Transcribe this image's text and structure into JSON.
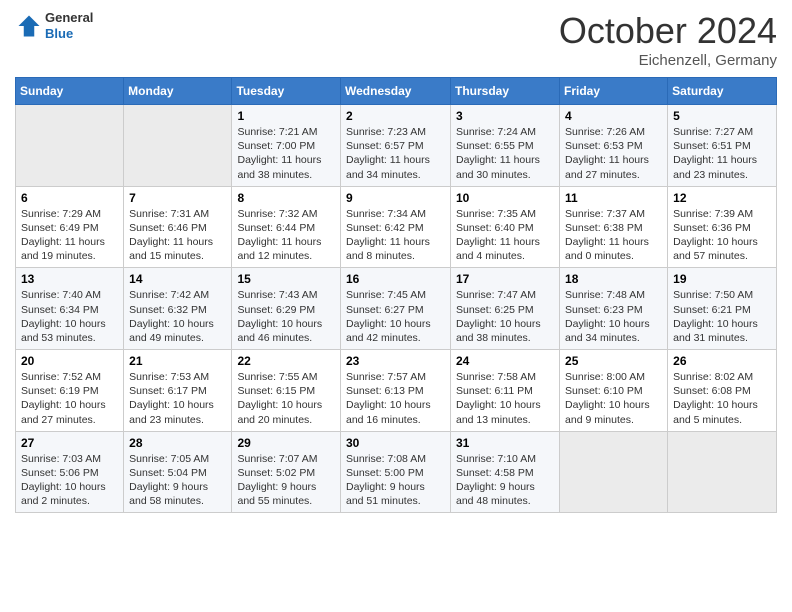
{
  "header": {
    "logo": {
      "general": "General",
      "blue": "Blue"
    },
    "month": "October 2024",
    "location": "Eichenzell, Germany"
  },
  "weekdays": [
    "Sunday",
    "Monday",
    "Tuesday",
    "Wednesday",
    "Thursday",
    "Friday",
    "Saturday"
  ],
  "weeks": [
    [
      {
        "day": "",
        "empty": true
      },
      {
        "day": "",
        "empty": true
      },
      {
        "day": "1",
        "sunrise": "Sunrise: 7:21 AM",
        "sunset": "Sunset: 7:00 PM",
        "daylight": "Daylight: 11 hours and 38 minutes."
      },
      {
        "day": "2",
        "sunrise": "Sunrise: 7:23 AM",
        "sunset": "Sunset: 6:57 PM",
        "daylight": "Daylight: 11 hours and 34 minutes."
      },
      {
        "day": "3",
        "sunrise": "Sunrise: 7:24 AM",
        "sunset": "Sunset: 6:55 PM",
        "daylight": "Daylight: 11 hours and 30 minutes."
      },
      {
        "day": "4",
        "sunrise": "Sunrise: 7:26 AM",
        "sunset": "Sunset: 6:53 PM",
        "daylight": "Daylight: 11 hours and 27 minutes."
      },
      {
        "day": "5",
        "sunrise": "Sunrise: 7:27 AM",
        "sunset": "Sunset: 6:51 PM",
        "daylight": "Daylight: 11 hours and 23 minutes."
      }
    ],
    [
      {
        "day": "6",
        "sunrise": "Sunrise: 7:29 AM",
        "sunset": "Sunset: 6:49 PM",
        "daylight": "Daylight: 11 hours and 19 minutes."
      },
      {
        "day": "7",
        "sunrise": "Sunrise: 7:31 AM",
        "sunset": "Sunset: 6:46 PM",
        "daylight": "Daylight: 11 hours and 15 minutes."
      },
      {
        "day": "8",
        "sunrise": "Sunrise: 7:32 AM",
        "sunset": "Sunset: 6:44 PM",
        "daylight": "Daylight: 11 hours and 12 minutes."
      },
      {
        "day": "9",
        "sunrise": "Sunrise: 7:34 AM",
        "sunset": "Sunset: 6:42 PM",
        "daylight": "Daylight: 11 hours and 8 minutes."
      },
      {
        "day": "10",
        "sunrise": "Sunrise: 7:35 AM",
        "sunset": "Sunset: 6:40 PM",
        "daylight": "Daylight: 11 hours and 4 minutes."
      },
      {
        "day": "11",
        "sunrise": "Sunrise: 7:37 AM",
        "sunset": "Sunset: 6:38 PM",
        "daylight": "Daylight: 11 hours and 0 minutes."
      },
      {
        "day": "12",
        "sunrise": "Sunrise: 7:39 AM",
        "sunset": "Sunset: 6:36 PM",
        "daylight": "Daylight: 10 hours and 57 minutes."
      }
    ],
    [
      {
        "day": "13",
        "sunrise": "Sunrise: 7:40 AM",
        "sunset": "Sunset: 6:34 PM",
        "daylight": "Daylight: 10 hours and 53 minutes."
      },
      {
        "day": "14",
        "sunrise": "Sunrise: 7:42 AM",
        "sunset": "Sunset: 6:32 PM",
        "daylight": "Daylight: 10 hours and 49 minutes."
      },
      {
        "day": "15",
        "sunrise": "Sunrise: 7:43 AM",
        "sunset": "Sunset: 6:29 PM",
        "daylight": "Daylight: 10 hours and 46 minutes."
      },
      {
        "day": "16",
        "sunrise": "Sunrise: 7:45 AM",
        "sunset": "Sunset: 6:27 PM",
        "daylight": "Daylight: 10 hours and 42 minutes."
      },
      {
        "day": "17",
        "sunrise": "Sunrise: 7:47 AM",
        "sunset": "Sunset: 6:25 PM",
        "daylight": "Daylight: 10 hours and 38 minutes."
      },
      {
        "day": "18",
        "sunrise": "Sunrise: 7:48 AM",
        "sunset": "Sunset: 6:23 PM",
        "daylight": "Daylight: 10 hours and 34 minutes."
      },
      {
        "day": "19",
        "sunrise": "Sunrise: 7:50 AM",
        "sunset": "Sunset: 6:21 PM",
        "daylight": "Daylight: 10 hours and 31 minutes."
      }
    ],
    [
      {
        "day": "20",
        "sunrise": "Sunrise: 7:52 AM",
        "sunset": "Sunset: 6:19 PM",
        "daylight": "Daylight: 10 hours and 27 minutes."
      },
      {
        "day": "21",
        "sunrise": "Sunrise: 7:53 AM",
        "sunset": "Sunset: 6:17 PM",
        "daylight": "Daylight: 10 hours and 23 minutes."
      },
      {
        "day": "22",
        "sunrise": "Sunrise: 7:55 AM",
        "sunset": "Sunset: 6:15 PM",
        "daylight": "Daylight: 10 hours and 20 minutes."
      },
      {
        "day": "23",
        "sunrise": "Sunrise: 7:57 AM",
        "sunset": "Sunset: 6:13 PM",
        "daylight": "Daylight: 10 hours and 16 minutes."
      },
      {
        "day": "24",
        "sunrise": "Sunrise: 7:58 AM",
        "sunset": "Sunset: 6:11 PM",
        "daylight": "Daylight: 10 hours and 13 minutes."
      },
      {
        "day": "25",
        "sunrise": "Sunrise: 8:00 AM",
        "sunset": "Sunset: 6:10 PM",
        "daylight": "Daylight: 10 hours and 9 minutes."
      },
      {
        "day": "26",
        "sunrise": "Sunrise: 8:02 AM",
        "sunset": "Sunset: 6:08 PM",
        "daylight": "Daylight: 10 hours and 5 minutes."
      }
    ],
    [
      {
        "day": "27",
        "sunrise": "Sunrise: 7:03 AM",
        "sunset": "Sunset: 5:06 PM",
        "daylight": "Daylight: 10 hours and 2 minutes."
      },
      {
        "day": "28",
        "sunrise": "Sunrise: 7:05 AM",
        "sunset": "Sunset: 5:04 PM",
        "daylight": "Daylight: 9 hours and 58 minutes."
      },
      {
        "day": "29",
        "sunrise": "Sunrise: 7:07 AM",
        "sunset": "Sunset: 5:02 PM",
        "daylight": "Daylight: 9 hours and 55 minutes."
      },
      {
        "day": "30",
        "sunrise": "Sunrise: 7:08 AM",
        "sunset": "Sunset: 5:00 PM",
        "daylight": "Daylight: 9 hours and 51 minutes."
      },
      {
        "day": "31",
        "sunrise": "Sunrise: 7:10 AM",
        "sunset": "Sunset: 4:58 PM",
        "daylight": "Daylight: 9 hours and 48 minutes."
      },
      {
        "day": "",
        "empty": true
      },
      {
        "day": "",
        "empty": true
      }
    ]
  ]
}
